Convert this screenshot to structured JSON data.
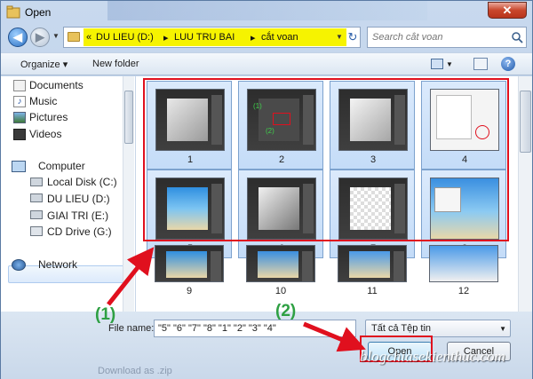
{
  "window": {
    "title": "Open",
    "close_glyph": "✕"
  },
  "navigation": {
    "back_glyph": "◀",
    "forward_glyph": "▶",
    "address": {
      "prefix": "«",
      "segments": [
        "DU LIEU (D:)",
        "LUU TRU BAI",
        "cắt voan"
      ],
      "separator": "▸"
    },
    "search_placeholder": "Search cắt voan"
  },
  "toolbar": {
    "organize_label": "Organize ▾",
    "new_folder_label": "New folder",
    "help_glyph": "?"
  },
  "sidebar": {
    "libraries": [
      "Documents",
      "Music",
      "Pictures",
      "Videos"
    ],
    "computer_label": "Computer",
    "drives": [
      "Local Disk (C:)",
      "DU LIEU (D:)",
      "GIAI TRI (E:)",
      "CD Drive (G:)"
    ],
    "network_label": "Network",
    "selected": "DU LIEU (D:)"
  },
  "files": [
    {
      "label": "1",
      "selected": true
    },
    {
      "label": "2",
      "selected": true
    },
    {
      "label": "3",
      "selected": true
    },
    {
      "label": "4",
      "selected": true
    },
    {
      "label": "5",
      "selected": true
    },
    {
      "label": "6",
      "selected": true
    },
    {
      "label": "7",
      "selected": true
    },
    {
      "label": "8",
      "selected": true
    },
    {
      "label": "9",
      "selected": false
    },
    {
      "label": "10",
      "selected": false
    },
    {
      "label": "11",
      "selected": false
    },
    {
      "label": "12",
      "selected": false
    }
  ],
  "thumb_annotations": {
    "t2_a": "(1)",
    "t2_b": "(2)"
  },
  "footer": {
    "filename_label": "File name:",
    "filename_value": "\"5\" \"6\" \"7\" \"8\" \"1\" \"2\" \"3\" \"4\"",
    "filetype_value": "Tất cả Tệp tin",
    "open_label": "Open",
    "cancel_label": "Cancel",
    "background_text": "Download as .zip"
  },
  "annotations": {
    "label_1": "(1)",
    "label_2": "(2)",
    "watermark": "blogchiasekienthuc.com"
  },
  "colors": {
    "highlight": "#f6f300",
    "annotation_red": "#e0101e",
    "annotation_green": "#2ea043",
    "selection": "#c4dcf8"
  }
}
